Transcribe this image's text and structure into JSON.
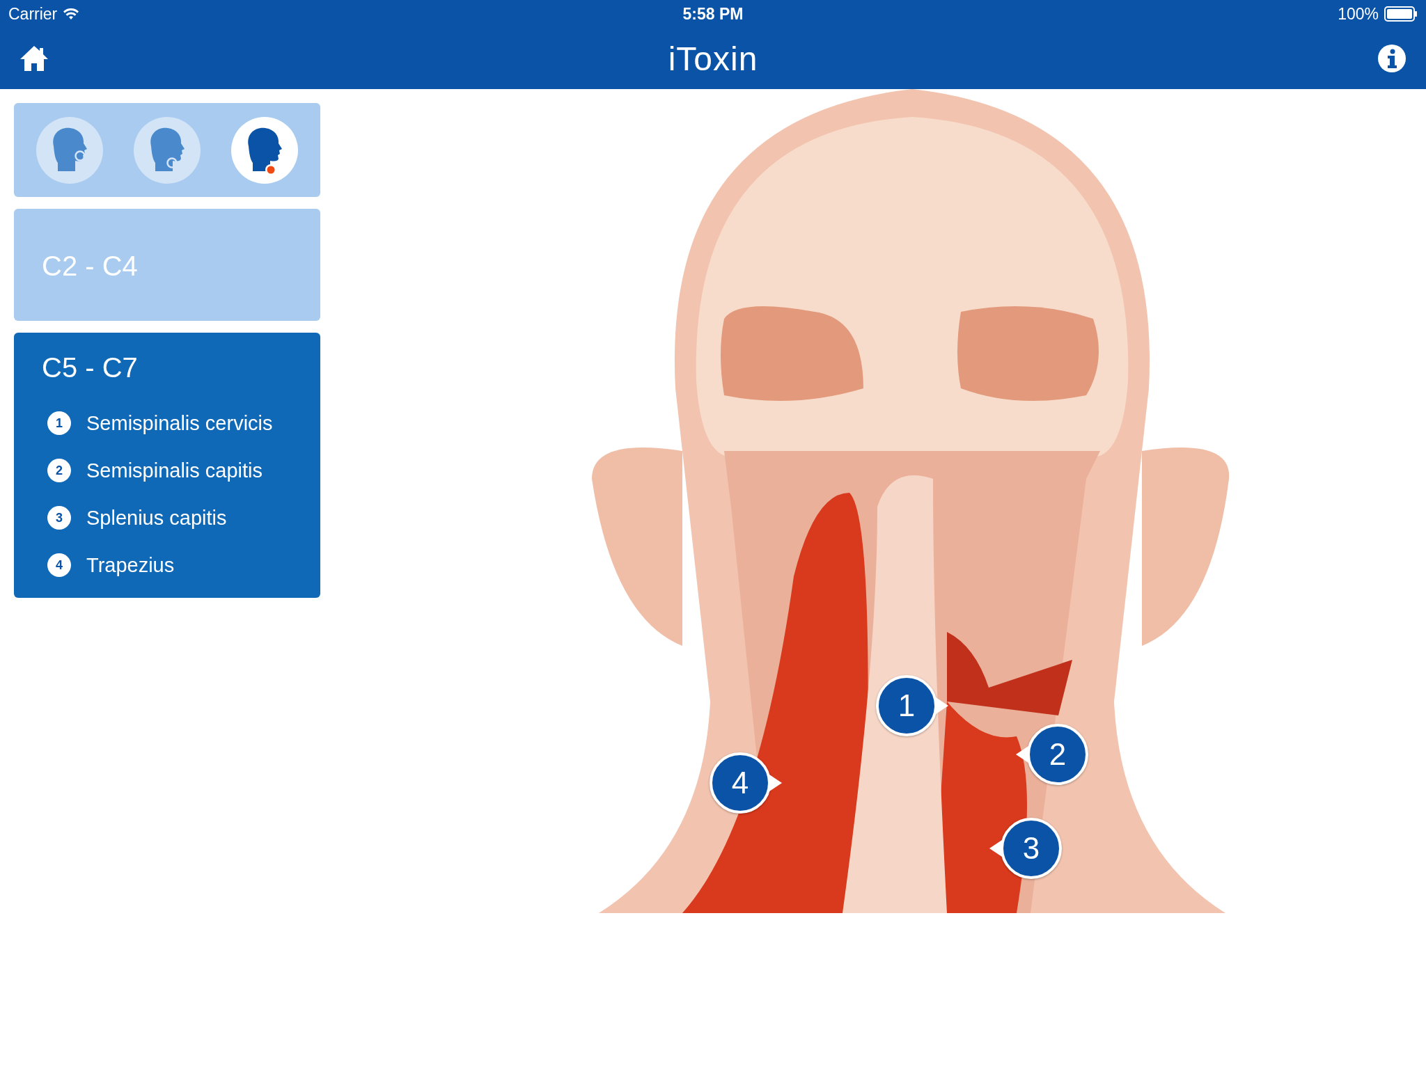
{
  "status_bar": {
    "carrier": "Carrier",
    "time": "5:58 PM",
    "battery": "100%"
  },
  "nav_bar": {
    "title": "iToxin"
  },
  "views": [
    {
      "kind": "face",
      "selected": false
    },
    {
      "kind": "jaw",
      "selected": false
    },
    {
      "kind": "neck",
      "selected": true
    }
  ],
  "sections": [
    {
      "title": "C2 - C4",
      "selected": false
    },
    {
      "title": "C5 - C7",
      "selected": true,
      "muscles": [
        {
          "number": "1",
          "name": "Semispinalis cervicis"
        },
        {
          "number": "2",
          "name": "Semispinalis capitis"
        },
        {
          "number": "3",
          "name": "Splenius capitis"
        },
        {
          "number": "4",
          "name": "Trapezius"
        }
      ]
    }
  ],
  "markers": [
    {
      "label": "1"
    },
    {
      "label": "2"
    },
    {
      "label": "3"
    },
    {
      "label": "4"
    }
  ]
}
